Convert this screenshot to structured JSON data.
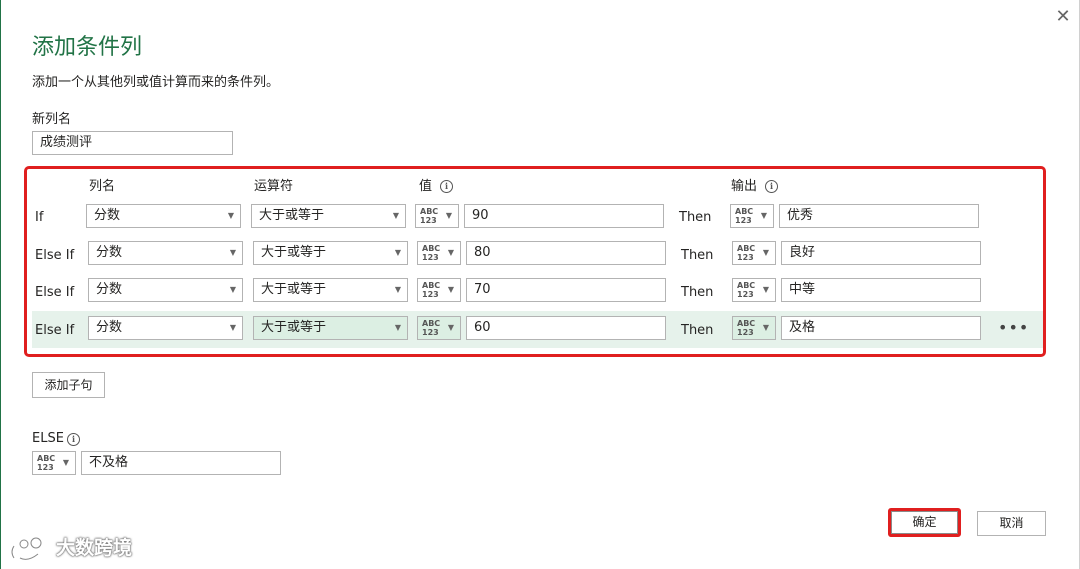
{
  "dialog": {
    "title": "添加条件列",
    "description": "添加一个从其他列或值计算而来的条件列。",
    "close_glyph": "✕"
  },
  "new_column": {
    "label": "新列名",
    "value": "成绩测评"
  },
  "headers": {
    "column": "列名",
    "operator": "运算符",
    "value": "值",
    "output": "输出"
  },
  "type_icon": {
    "top": "ABC",
    "bottom": "123"
  },
  "rules": [
    {
      "keyword": "If",
      "column": "分数",
      "operator": "大于或等于",
      "value": "90",
      "then": "Then",
      "output": "优秀"
    },
    {
      "keyword": "Else If",
      "column": "分数",
      "operator": "大于或等于",
      "value": "80",
      "then": "Then",
      "output": "良好"
    },
    {
      "keyword": "Else If",
      "column": "分数",
      "operator": "大于或等于",
      "value": "70",
      "then": "Then",
      "output": "中等"
    },
    {
      "keyword": "Else If",
      "column": "分数",
      "operator": "大于或等于",
      "value": "60",
      "then": "Then",
      "output": "及格"
    }
  ],
  "more_glyph": "•••",
  "add_clause_label": "添加子句",
  "else": {
    "label": "ELSE",
    "value": "不及格"
  },
  "footer": {
    "ok_label": "确定",
    "cancel_label": "取消"
  },
  "watermark": {
    "text": "大数跨境"
  },
  "colors": {
    "accent": "#217346",
    "highlight_box": "#e01f1f",
    "row_highlight": "#e6f2eb"
  }
}
